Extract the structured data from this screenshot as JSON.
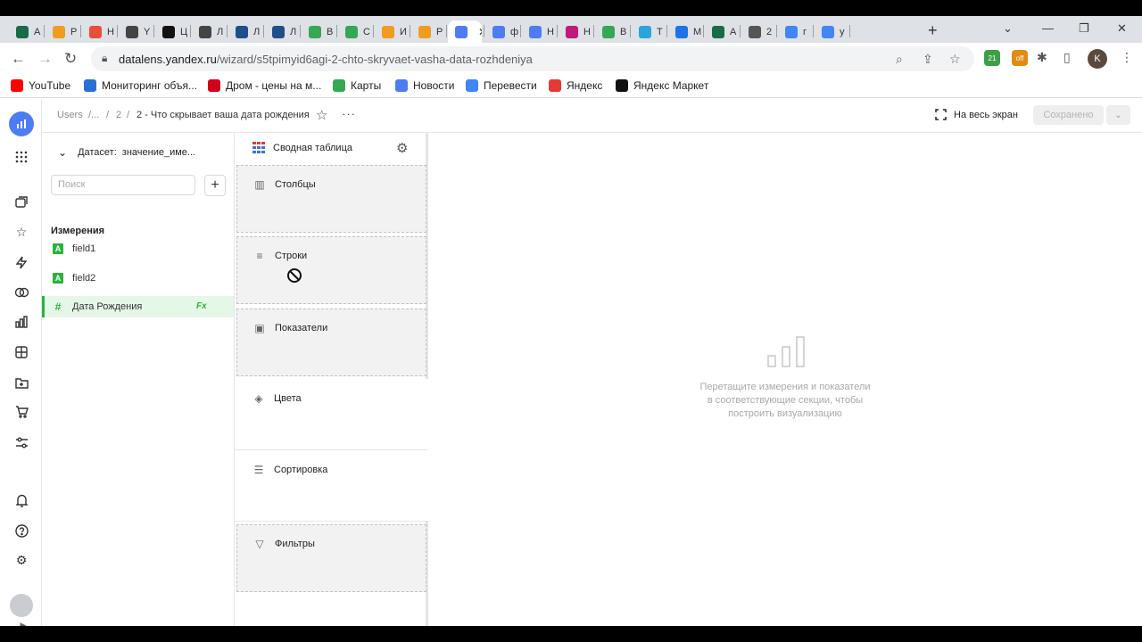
{
  "browser": {
    "tabs": [
      {
        "label": "A",
        "icon": "hat-icon",
        "color": "#1a6b45"
      },
      {
        "label": "P",
        "icon": "infinity-icon",
        "color": "#f29c1f"
      },
      {
        "label": "H",
        "icon": "grid-flower-icon",
        "color": "#e94e3c"
      },
      {
        "label": "Y",
        "icon": "globe-icon",
        "color": "#444444"
      },
      {
        "label": "Ц",
        "icon": "ban-icon",
        "color": "#111111"
      },
      {
        "label": "Л",
        "icon": "globe-icon",
        "color": "#444444"
      },
      {
        "label": "Л",
        "icon": "owl-icon",
        "color": "#1f4e8c"
      },
      {
        "label": "Л",
        "icon": "owl-icon",
        "color": "#1f4e8c"
      },
      {
        "label": "В",
        "icon": "drive-icon",
        "color": "#34a853"
      },
      {
        "label": "С",
        "icon": "drive-icon",
        "color": "#34a853"
      },
      {
        "label": "И",
        "icon": "infinity-icon",
        "color": "#f29c1f"
      },
      {
        "label": "P",
        "icon": "infinity-icon",
        "color": "#f29c1f"
      },
      {
        "label": "",
        "icon": "datalens-icon",
        "color": "#4d7cf4",
        "active": true
      },
      {
        "label": "ф",
        "icon": "datalens-icon",
        "color": "#4d7cf4"
      },
      {
        "label": "Н",
        "icon": "datalens-icon",
        "color": "#4d7cf4"
      },
      {
        "label": "Н",
        "icon": "arrow-icon",
        "color": "#c2187a"
      },
      {
        "label": "В",
        "icon": "drive-icon",
        "color": "#34a853"
      },
      {
        "label": "Т",
        "icon": "telegram-icon",
        "color": "#2aa3df"
      },
      {
        "label": "М",
        "icon": "chat-icon",
        "color": "#1f73e8"
      },
      {
        "label": "А",
        "icon": "hat-icon",
        "color": "#1a6b45"
      },
      {
        "label": "2",
        "icon": "at-icon",
        "color": "#555555"
      },
      {
        "label": "г",
        "icon": "google-icon",
        "color": "#4285f4"
      },
      {
        "label": "у",
        "icon": "google-icon",
        "color": "#4285f4"
      }
    ],
    "url_host": "datalens.yandex.ru",
    "url_path": "/wizard/s5tpimyid6agi-2-chto-skryvaet-vasha-data-rozhdeniya",
    "profile_initial": "K",
    "ext_badge_1": "21",
    "ext_badge_2": "off",
    "bookmarks": [
      {
        "label": "YouTube",
        "icon": "youtube-icon",
        "color": "#ff0000"
      },
      {
        "label": "Мониторинг объя...",
        "icon": "car-icon",
        "color": "#2a6fd6"
      },
      {
        "label": "Дром - цены на м...",
        "icon": "drom-icon",
        "color": "#d0021b"
      },
      {
        "label": "Карты",
        "icon": "maps-icon",
        "color": "#34a853"
      },
      {
        "label": "Новости",
        "icon": "news-icon",
        "color": "#4d7cf4"
      },
      {
        "label": "Перевести",
        "icon": "translate-icon",
        "color": "#4285f4"
      },
      {
        "label": "Яндекс",
        "icon": "yandex-icon",
        "color": "#e53935"
      },
      {
        "label": "Яндекс Маркет",
        "icon": "market-icon",
        "color": "#111111"
      }
    ]
  },
  "header": {
    "breadcrumbs": [
      "Users",
      "/...",
      "/",
      "2",
      "/",
      "2 - Что скрывает ваша дата рождения"
    ],
    "fullscreen_label": "На весь экран",
    "saved_label": "Сохранено"
  },
  "dataset": {
    "label": "Датасет:",
    "value": "значение_име...",
    "search_placeholder": "Поиск",
    "dimensions_title": "Измерения",
    "fields": [
      {
        "name": "field1",
        "type": "A"
      },
      {
        "name": "field2",
        "type": "A"
      },
      {
        "name": "Дата Рождения",
        "type": "#",
        "fx": "Fx",
        "selected": true
      }
    ]
  },
  "visualization": {
    "type_label": "Сводная таблица",
    "sections": [
      {
        "label": "Столбцы",
        "icon": "columns-icon",
        "dropzone": true
      },
      {
        "label": "Строки",
        "icon": "rows-icon",
        "dropzone": true
      },
      {
        "label": "Показатели",
        "icon": "measure-icon",
        "dropzone": true
      },
      {
        "label": "Цвета",
        "icon": "paint-bucket-icon",
        "dropzone": false
      },
      {
        "label": "Сортировка",
        "icon": "sort-icon",
        "dropzone": false
      },
      {
        "label": "Фильтры",
        "icon": "filter-icon",
        "dropzone": true
      }
    ]
  },
  "canvas": {
    "empty_text_1": "Перетащите измерения и показатели",
    "empty_text_2": "в соответствующие секции, чтобы",
    "empty_text_3": "построить визуализацию"
  },
  "colors": {
    "accent": "#4d7cf4",
    "field_green": "#27b43b",
    "selected_bg": "#e5f7e7"
  }
}
